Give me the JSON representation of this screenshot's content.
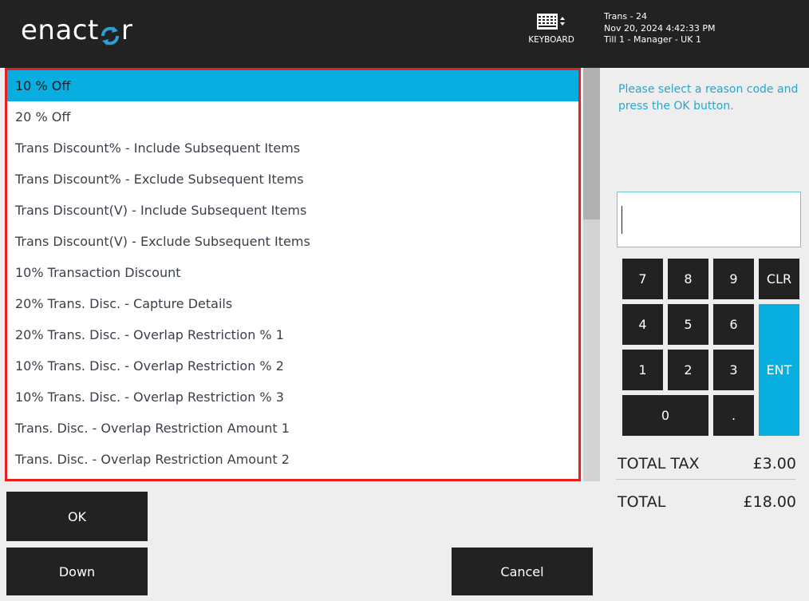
{
  "header": {
    "logo_prefix": "enact",
    "logo_suffix": "r",
    "keyboard_label": "KEYBOARD",
    "trans": "Trans - 24",
    "datetime": "Nov 20, 2024 4:42:33 PM",
    "till": "Till 1 - Manager - UK 1"
  },
  "reason_list": {
    "selected_index": 0,
    "items": [
      "10 % Off",
      "20 % Off",
      "Trans Discount% - Include Subsequent Items",
      "Trans Discount% - Exclude Subsequent Items",
      "Trans Discount(V) - Include Subsequent Items",
      "Trans Discount(V) - Exclude Subsequent Items",
      "10% Transaction Discount",
      "20% Trans. Disc. - Capture Details",
      "20% Trans. Disc. - Overlap Restriction % 1",
      "10% Trans. Disc. - Overlap Restriction % 2",
      "10% Trans. Disc. - Overlap Restriction % 3",
      "Trans. Disc. - Overlap Restriction Amount 1",
      "Trans. Disc. - Overlap Restriction Amount 2"
    ]
  },
  "prompt": "Please select a reason code and press the OK button.",
  "entry": {
    "value": ""
  },
  "keypad": {
    "k7": "7",
    "k8": "8",
    "k9": "9",
    "clr": "CLR",
    "k4": "4",
    "k5": "5",
    "k6": "6",
    "k1": "1",
    "k2": "2",
    "k3": "3",
    "ent": "ENT",
    "k0": "0",
    "dot": "."
  },
  "totals": {
    "tax_label": "TOTAL TAX",
    "tax_value": "£3.00",
    "total_label": "TOTAL",
    "total_value": "£18.00"
  },
  "buttons": {
    "ok": "OK",
    "down": "Down",
    "cancel": "Cancel"
  },
  "colors": {
    "accent": "#08aee0",
    "header_bg": "#222222",
    "highlight_border": "#e81e1e",
    "prompt_text": "#24a7d0"
  }
}
